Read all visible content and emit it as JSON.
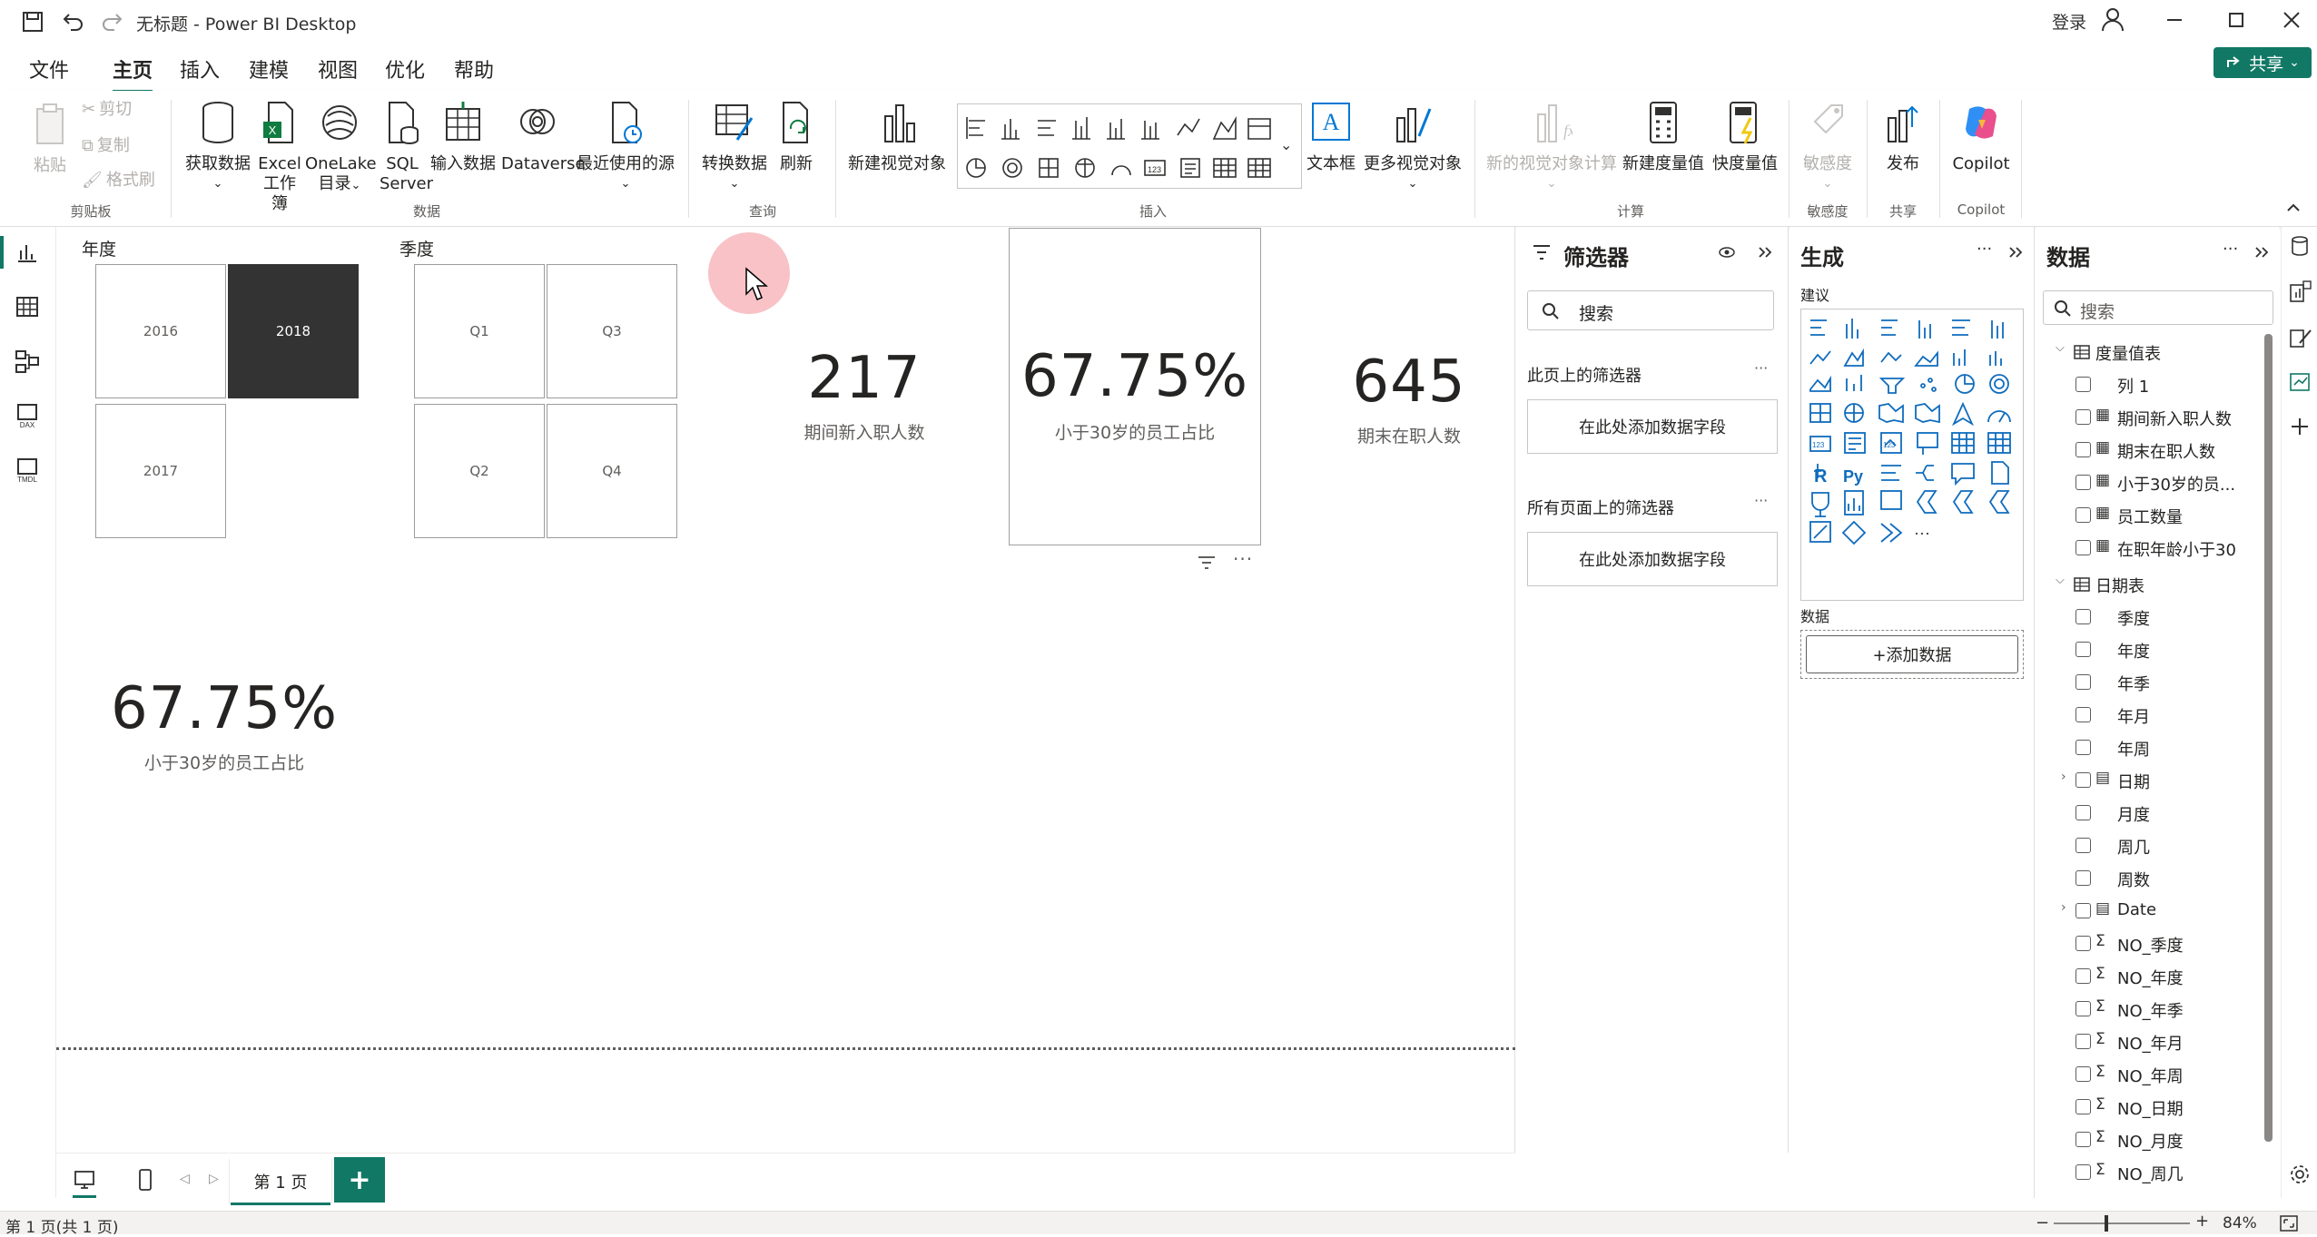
{
  "titlebar": {
    "title": "无标题 - Power BI Desktop",
    "signin": "登录"
  },
  "menu": {
    "file": "文件",
    "home": "主页",
    "insert": "插入",
    "modeling": "建模",
    "view": "视图",
    "optimize": "优化",
    "help": "帮助",
    "share": "共享"
  },
  "ribbon": {
    "paste": "粘贴",
    "cut": "剪切",
    "copy": "复制",
    "format_painter": "格式刷",
    "clipboard_group": "剪贴板",
    "get_data": "获取数据",
    "excel_l1": "Excel",
    "excel_l2": "工作簿",
    "onelake_l1": "OneLake",
    "onelake_l2": "目录",
    "sql_l1": "SQL",
    "sql_l2": "Server",
    "enter_data": "输入数据",
    "dataverse": "Dataverse",
    "recent_sources": "最近使用的源",
    "data_group": "数据",
    "transform": "转换数据",
    "refresh": "刷新",
    "query_group": "查询",
    "new_visual": "新建视觉对象",
    "textbox": "文本框",
    "more_visuals": "更多视觉对象",
    "insert_group": "插入",
    "new_visual_calc": "新的视觉对象计算",
    "new_measure": "新建度量值",
    "quick_measure": "快度量值",
    "calc_group": "计算",
    "sensitivity": "敏感度",
    "sensitivity_group": "敏感度",
    "publish": "发布",
    "share_group": "共享",
    "copilot": "Copilot",
    "copilot_group": "Copilot"
  },
  "canvas": {
    "year_slicer": {
      "title": "年度",
      "items": [
        "2016",
        "2018",
        "2017"
      ],
      "selected": "2018"
    },
    "quarter_slicer": {
      "title": "季度",
      "items": [
        "Q1",
        "Q3",
        "Q2",
        "Q4"
      ]
    },
    "card1": {
      "value": "217",
      "label": "期间新入职人数"
    },
    "card2": {
      "value": "67.75%",
      "label": "小于30岁的员工占比"
    },
    "card3": {
      "value": "645",
      "label": "期末在职人数"
    },
    "card4": {
      "value": "67.75%",
      "label": "小于30岁的员工占比"
    }
  },
  "filters": {
    "title": "筛选器",
    "search_placeholder": "搜索",
    "page_filters": "此页上的筛选器",
    "all_page_filters": "所有页面上的筛选器",
    "drop_here": "在此处添加数据字段"
  },
  "build": {
    "title": "生成",
    "suggest": "建议",
    "data_label": "数据",
    "add_data": "+添加数据"
  },
  "data": {
    "title": "数据",
    "search_placeholder": "搜索",
    "table1": "度量值表",
    "measures": [
      "列 1",
      "期间新入职人数",
      "期末在职人数",
      "小于30岁的员...",
      "员工数量",
      "在职年龄小于30"
    ],
    "table2": "日期表",
    "date_fields": [
      "季度",
      "年度",
      "年季",
      "年月",
      "年周",
      "日期",
      "月度",
      "周几",
      "周数",
      "Date",
      "NO_季度",
      "NO_年度",
      "NO_年季",
      "NO_年月",
      "NO_年周",
      "NO_日期",
      "NO_月度",
      "NO_周几"
    ]
  },
  "tabs": {
    "page1": "第 1 页"
  },
  "status": {
    "pages": "第 1 页(共 1 页)",
    "zoom": "84%"
  },
  "colors": {
    "accent": "#117865",
    "selected_slicer": "#333333"
  }
}
